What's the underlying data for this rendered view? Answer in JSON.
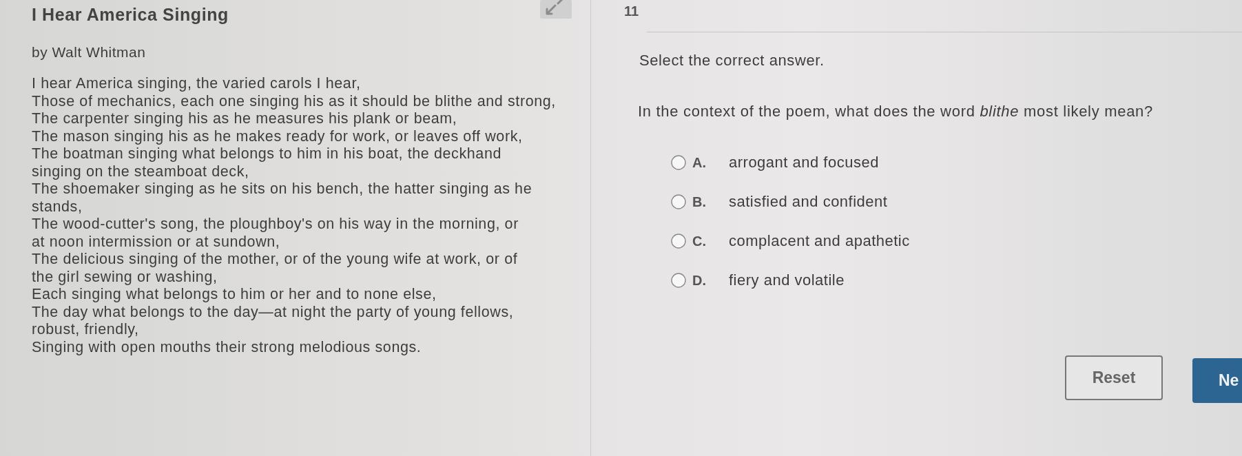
{
  "header": {
    "title": "I Hear America Singing",
    "question_number": "11"
  },
  "passage": {
    "byline": "by Walt Whitman",
    "verses": [
      {
        "lines": [
          "I hear America singing, the varied carols I hear,"
        ]
      },
      {
        "lines": [
          "Those of mechanics, each one singing his as it should be blithe and strong,"
        ]
      },
      {
        "lines": [
          "The carpenter singing his as he measures his plank or beam,"
        ]
      },
      {
        "lines": [
          "The mason singing his as he makes ready for work, or leaves off work,"
        ]
      },
      {
        "lines": [
          "The boatman singing what belongs to him in his boat, the deckhand",
          "singing on the steamboat deck,"
        ]
      },
      {
        "lines": [
          "The shoemaker singing as he sits on his bench, the hatter singing as he",
          "stands,"
        ]
      },
      {
        "lines": [
          "The wood-cutter's song, the ploughboy's on his way in the morning, or",
          "at noon intermission or at sundown,"
        ]
      },
      {
        "lines": [
          "The delicious singing of the mother, or of the young wife at work, or of",
          "the girl sewing or washing,"
        ]
      },
      {
        "lines": [
          "Each singing what belongs to him or her and to none else,"
        ]
      },
      {
        "lines": [
          "The day what belongs to the day—at night the party of young fellows,",
          "robust, friendly,"
        ]
      },
      {
        "lines": [
          "Singing with open mouths their strong melodious songs."
        ]
      }
    ]
  },
  "question": {
    "instruction": "Select the correct answer.",
    "prompt": "In the context of the poem, what does the word *blithe* most likely mean?",
    "options": [
      {
        "letter": "A.",
        "text": "arrogant and focused",
        "selected": false
      },
      {
        "letter": "B.",
        "text": "satisfied and confident",
        "selected": false
      },
      {
        "letter": "C.",
        "text": "complacent and apathetic",
        "selected": false
      },
      {
        "letter": "D.",
        "text": "fiery and volatile",
        "selected": false
      }
    ]
  },
  "buttons": [
    {
      "label": "Reset",
      "kind": "secondary"
    },
    {
      "label": "Ne",
      "kind": "primary"
    }
  ]
}
